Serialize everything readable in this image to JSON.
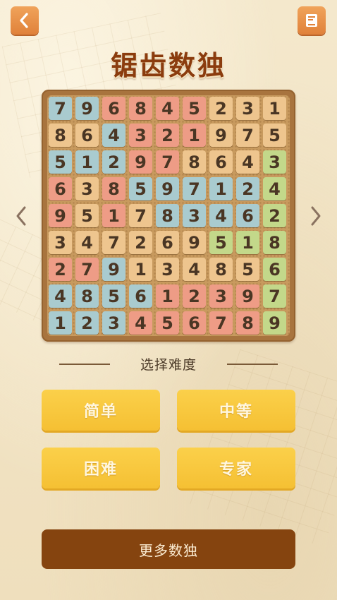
{
  "title": "锯齿数独",
  "section_label": "选择难度",
  "difficulty_buttons": [
    {
      "label": "简单"
    },
    {
      "label": "中等"
    },
    {
      "label": "困难"
    },
    {
      "label": "专家"
    }
  ],
  "more_button": {
    "label": "更多数独"
  },
  "icons": {
    "back": "chevron-left-icon",
    "help": "book-icon",
    "prev": "chevron-left-icon",
    "next": "chevron-right-icon"
  },
  "colors": {
    "blue": "#a9cbcf",
    "pink": "#ee9c86",
    "tan": "#eec58e",
    "green": "#c3d88a",
    "button_yellow": "#f8c73e",
    "button_brown": "#85440f",
    "accent_orange": "#e8913f",
    "title_brown": "#8b3c0e"
  },
  "board": {
    "rows": [
      [
        "7",
        "9",
        "6",
        "8",
        "4",
        "5",
        "2",
        "3",
        "1"
      ],
      [
        "8",
        "6",
        "4",
        "3",
        "2",
        "1",
        "9",
        "7",
        "5"
      ],
      [
        "5",
        "1",
        "2",
        "9",
        "7",
        "8",
        "6",
        "4",
        "3"
      ],
      [
        "6",
        "3",
        "8",
        "5",
        "9",
        "7",
        "1",
        "2",
        "4"
      ],
      [
        "9",
        "5",
        "1",
        "7",
        "8",
        "3",
        "4",
        "6",
        "2"
      ],
      [
        "3",
        "4",
        "7",
        "2",
        "6",
        "9",
        "5",
        "1",
        "8"
      ],
      [
        "2",
        "7",
        "9",
        "1",
        "3",
        "4",
        "8",
        "5",
        "6"
      ],
      [
        "4",
        "8",
        "5",
        "6",
        "1",
        "2",
        "3",
        "9",
        "7"
      ],
      [
        "1",
        "2",
        "3",
        "4",
        "5",
        "6",
        "7",
        "8",
        "9"
      ]
    ],
    "regions": [
      [
        "B",
        "B",
        "P",
        "P",
        "P",
        "P",
        "T",
        "T",
        "T"
      ],
      [
        "T",
        "T",
        "B",
        "P",
        "P",
        "P",
        "T",
        "T",
        "T"
      ],
      [
        "B",
        "B",
        "B",
        "P",
        "P",
        "T",
        "T",
        "T",
        "G"
      ],
      [
        "P",
        "T",
        "P",
        "B",
        "B",
        "B",
        "B",
        "B",
        "G"
      ],
      [
        "P",
        "T",
        "P",
        "T",
        "B",
        "B",
        "B",
        "B",
        "G"
      ],
      [
        "T",
        "T",
        "T",
        "T",
        "T",
        "T",
        "G",
        "G",
        "G"
      ],
      [
        "P",
        "P",
        "B",
        "T",
        "T",
        "T",
        "T",
        "T",
        "G"
      ],
      [
        "B",
        "B",
        "B",
        "B",
        "P",
        "P",
        "P",
        "P",
        "G"
      ],
      [
        "B",
        "B",
        "B",
        "P",
        "P",
        "P",
        "P",
        "P",
        "G"
      ]
    ]
  }
}
